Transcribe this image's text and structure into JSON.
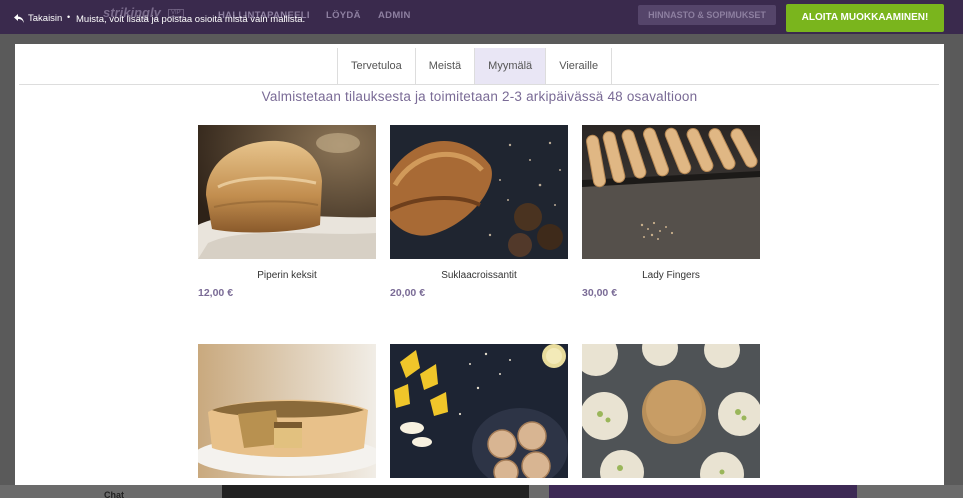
{
  "topbar": {
    "back_label": "Takaisin",
    "separator": "•",
    "note": "Muista, voit lisätä ja poistaa osioita mistä vain mallista.",
    "brand": "strikingly",
    "brand_badge": "VIP",
    "nav": [
      "HALLINTAPANEELI",
      "LÖYDÄ",
      "ADMIN"
    ],
    "pricing_label": "HINNASTO & SOPIMUKSET",
    "cta_label": "ALOITA MUOKKAAMINEN!",
    "cta_color": "#7ab51d"
  },
  "background": {
    "label": "Chat"
  },
  "preview": {
    "tabs": [
      {
        "label": "Tervetuloa",
        "active": false
      },
      {
        "label": "Meistä",
        "active": false
      },
      {
        "label": "Myymälä",
        "active": true
      },
      {
        "label": "Vieraille",
        "active": false
      }
    ],
    "headline": "Valmistetaan tilauksesta ja toimitetaan 2-3 arkipäivässä 48 osavaltioon",
    "accent_color": "#7a6b96",
    "products": [
      {
        "name": "Piperin keksit",
        "price": "12,00 €",
        "image": "bread-loaf-photo"
      },
      {
        "name": "Suklaacroissantit",
        "price": "20,00 €",
        "image": "croissant-photo"
      },
      {
        "name": "Lady Fingers",
        "price": "30,00 €",
        "image": "lady-fingers-photo"
      },
      {
        "name": "",
        "price": "",
        "image": "quiche-photo"
      },
      {
        "name": "",
        "price": "",
        "image": "cookies-flowers-photo"
      },
      {
        "name": "",
        "price": "",
        "image": "pistachio-cookies-photo"
      }
    ]
  }
}
